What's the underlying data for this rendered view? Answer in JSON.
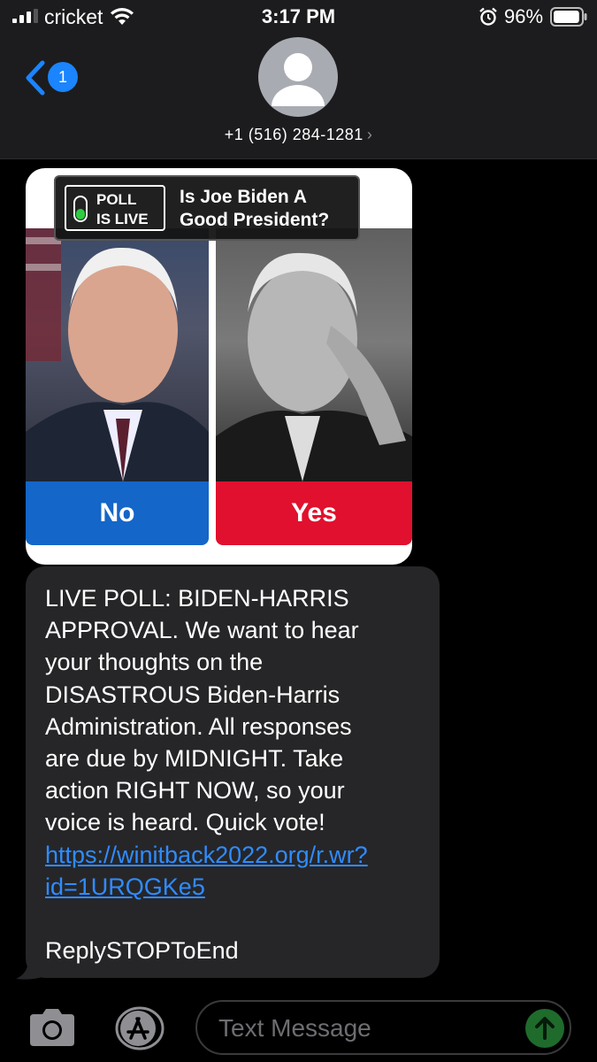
{
  "status_bar": {
    "carrier": "cricket",
    "time": "3:17 PM",
    "battery_percent": "96%",
    "battery_level": 0.96,
    "signal_bars": 3
  },
  "header": {
    "back_badge": "1",
    "contact": "+1 (516) 284-1281",
    "contact_chevron": "›"
  },
  "poll_image": {
    "live_label_line1": "POLL",
    "live_label_line2": "IS LIVE",
    "question_line1": "Is Joe Biden A",
    "question_line2": "Good President?",
    "option_no": "No",
    "option_yes": "Yes",
    "colors": {
      "no": "#1466c8",
      "yes": "#e0102e"
    }
  },
  "message": {
    "lines": [
      "LIVE POLL: BIDEN-HARRIS",
      "APPROVAL. We want to hear",
      "your thoughts on the",
      "DISASTROUS Biden-Harris",
      "Administration. All responses",
      "are due by MIDNIGHT. Take",
      "action RIGHT NOW, so your",
      "voice is heard. Quick vote!"
    ],
    "link_line1": "https://winitback2022.org/r.wr?",
    "link_line2": "id=1URQGKe5",
    "footer": "ReplySTOPToEnd"
  },
  "input_bar": {
    "placeholder": "Text Message",
    "icons": [
      "camera-icon",
      "app-store-icon",
      "send-arrow-icon"
    ]
  },
  "colors": {
    "accent": "#1b84ff",
    "link": "#2f8cff",
    "bubble": "#262628"
  }
}
